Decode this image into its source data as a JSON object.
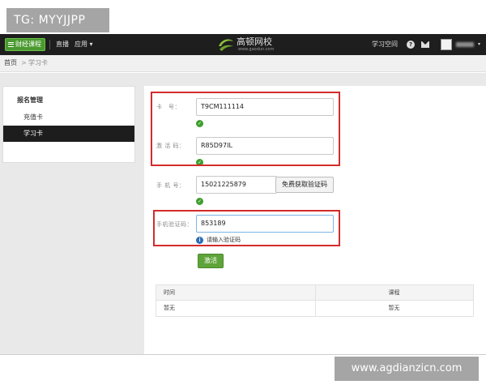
{
  "watermarks": {
    "top": "TG: MYYJJPP",
    "bottom": "www.agdianzicn.com"
  },
  "navbar": {
    "course_button": "财经课程",
    "live": "直播",
    "apps": "应用 ▾",
    "logo_title": "高顿网校",
    "logo_url": "www.gaodun.com",
    "study_space": "学习空间",
    "help_icon": "?",
    "user_caret": "▾"
  },
  "breadcrumb": {
    "home": "首页",
    "separator": ">",
    "current": "学习卡"
  },
  "sidebar": {
    "title": "报名管理",
    "items": [
      {
        "label": "充值卡",
        "active": false
      },
      {
        "label": "学习卡",
        "active": true
      }
    ]
  },
  "form": {
    "card_number": {
      "label": "卡　号：",
      "value": "T9CM111114",
      "valid": true
    },
    "activation_code": {
      "label": "激 活 码：",
      "value": "R85D97IL",
      "valid": true
    },
    "phone": {
      "label": "手 机 号：",
      "value": "15021225879",
      "valid": true,
      "sms_button": "免费获取验证码"
    },
    "sms_code": {
      "label": "手机验证码：",
      "value": "853189",
      "hint": "请输入验证码"
    },
    "submit": "激活"
  },
  "table": {
    "headers": [
      "时间",
      "课程"
    ],
    "rows": [
      [
        "暂无",
        "暂无"
      ]
    ]
  },
  "colors": {
    "highlight": "#d42b2b",
    "brand_green": "#5fa43a",
    "nav_bg": "#1e1e1e"
  }
}
